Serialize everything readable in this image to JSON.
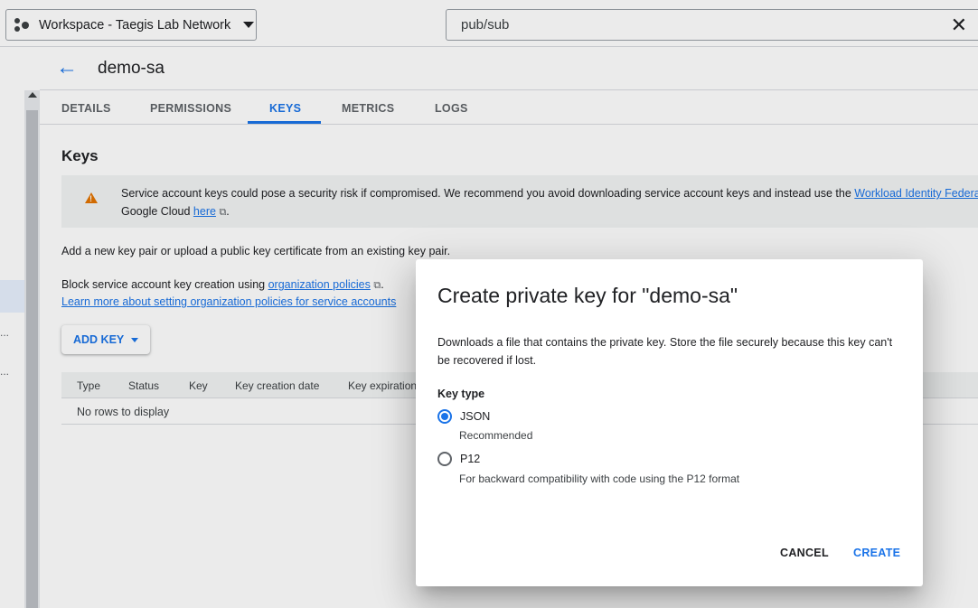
{
  "topbar": {
    "workspace_label": "Workspace - Taegis Lab Network",
    "search_value": "pub/sub",
    "clear_glyph": "✕"
  },
  "sidebar": {
    "ellipsis_1": "...",
    "ellipsis_2": "..."
  },
  "header": {
    "back_glyph": "←",
    "title": "demo-sa"
  },
  "tabs": [
    {
      "label": "DETAILS",
      "active": false
    },
    {
      "label": "PERMISSIONS",
      "active": false
    },
    {
      "label": "KEYS",
      "active": true
    },
    {
      "label": "METRICS",
      "active": false
    },
    {
      "label": "LOGS",
      "active": false
    }
  ],
  "keys": {
    "heading": "Keys",
    "warning": {
      "text": "Service account keys could pose a security risk if compromised. We recommend you avoid downloading service account keys and instead use the ",
      "link1": "Workload Identity Federation",
      "line2_prefix": "Google Cloud ",
      "link2": "here",
      "ext_glyph": "⧉",
      "line2_suffix": "."
    },
    "add_description": "Add a new key pair or upload a public key certificate from an existing key pair.",
    "block_prefix": "Block service account key creation using ",
    "block_link": "organization policies",
    "block_suffix": ".",
    "learn_more_link": "Learn more about setting organization policies for service accounts",
    "add_key_label": "ADD KEY",
    "table": {
      "columns": [
        "Type",
        "Status",
        "Key",
        "Key creation date",
        "Key expiration date"
      ],
      "empty_text": "No rows to display"
    }
  },
  "dialog": {
    "title": "Create private key for \"demo-sa\"",
    "description": "Downloads a file that contains the private key. Store the file securely because this key can't be recovered if lost.",
    "key_type_label": "Key type",
    "options": [
      {
        "label": "JSON",
        "hint": "Recommended",
        "selected": true
      },
      {
        "label": "P12",
        "hint": "For backward compatibility with code using the P12 format",
        "selected": false
      }
    ],
    "cancel_label": "CANCEL",
    "create_label": "CREATE"
  },
  "colors": {
    "accent": "#1a73e8",
    "warning": "#e37400"
  }
}
